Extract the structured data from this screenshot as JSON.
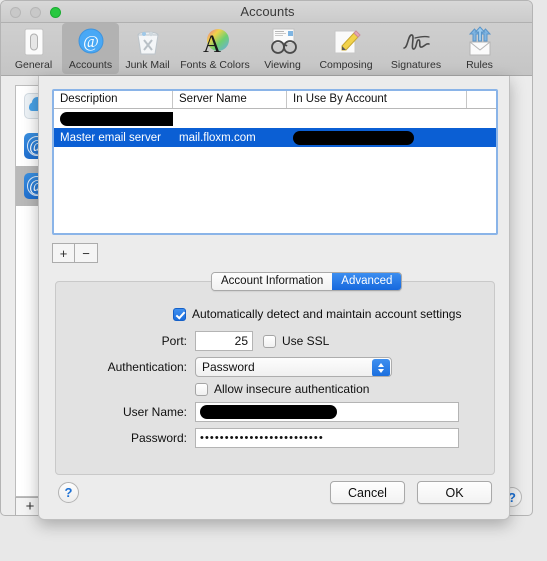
{
  "window": {
    "title": "Accounts",
    "traffic_lights": [
      "close-button",
      "minimize-button",
      "zoom-button"
    ],
    "help_label": "?"
  },
  "toolbar": {
    "items": [
      {
        "label": "General",
        "icon": "general-icon",
        "selected": false
      },
      {
        "label": "Accounts",
        "icon": "accounts-at-icon",
        "selected": true
      },
      {
        "label": "Junk Mail",
        "icon": "junk-mail-trash-icon",
        "selected": false
      },
      {
        "label": "Fonts & Colors",
        "icon": "fonts-colors-icon",
        "selected": false
      },
      {
        "label": "Viewing",
        "icon": "viewing-glasses-icon",
        "selected": false
      },
      {
        "label": "Composing",
        "icon": "composing-pencil-icon",
        "selected": false
      },
      {
        "label": "Signatures",
        "icon": "signature-icon",
        "selected": false
      },
      {
        "label": "Rules",
        "icon": "rules-envelope-icon",
        "selected": false
      }
    ]
  },
  "accounts_sidebar": {
    "items": [
      {
        "icon": "icloud-icon",
        "selected": false
      },
      {
        "icon": "at-account-icon",
        "selected": false
      },
      {
        "icon": "at-account-icon",
        "selected": true
      }
    ],
    "add_label": "+"
  },
  "sheet": {
    "server_table": {
      "columns": [
        "Description",
        "Server Name",
        "In Use By Account"
      ],
      "rows": [
        {
          "description": "",
          "server_name": "",
          "in_use_by": "",
          "redacted": true,
          "selected": false
        },
        {
          "description": "Master email server",
          "server_name": "mail.floxm.com",
          "in_use_by": "",
          "redacted_account": true,
          "selected": true
        }
      ]
    },
    "list_buttons": {
      "add": "+",
      "remove": "−"
    },
    "tabs": [
      {
        "label": "Account Information",
        "active": false
      },
      {
        "label": "Advanced",
        "active": true
      }
    ],
    "form": {
      "auto_detect": {
        "label": "Automatically detect and maintain account settings",
        "checked": true
      },
      "port": {
        "label": "Port:",
        "value": "25"
      },
      "use_ssl": {
        "label": "Use SSL",
        "checked": false
      },
      "authentication": {
        "label": "Authentication:",
        "value": "Password"
      },
      "allow_insecure": {
        "label": "Allow insecure authentication",
        "checked": false
      },
      "user_name": {
        "label": "User Name:",
        "value": "",
        "redacted": true
      },
      "password": {
        "label": "Password:",
        "value": "•••••••••••••••••••••••••"
      }
    },
    "buttons": {
      "help": "?",
      "cancel": "Cancel",
      "ok": "OK"
    }
  },
  "colors": {
    "selection_blue": "#0b5fd4",
    "accent_blue": "#1a6ddd",
    "focus_ring": "#8ab4e8",
    "window_bg": "#ececec"
  }
}
